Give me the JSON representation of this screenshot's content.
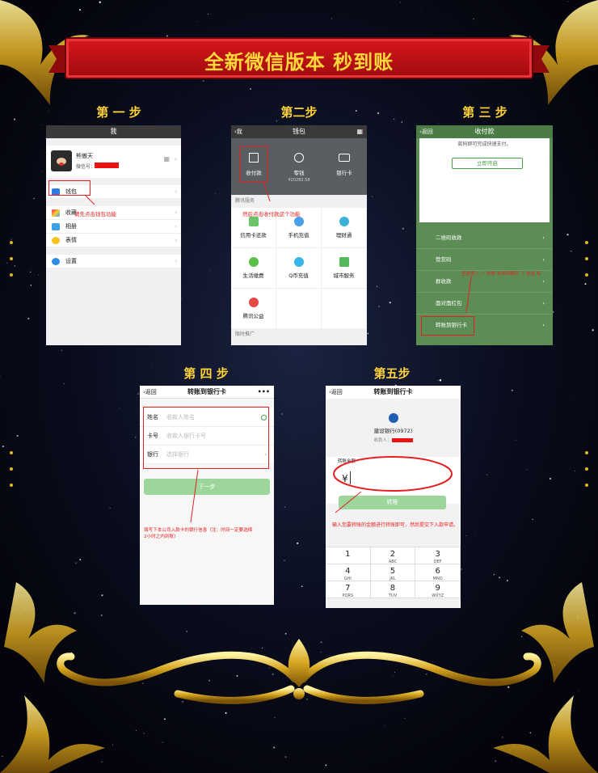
{
  "banner": {
    "title": "全新微信版本  秒到账"
  },
  "steps": {
    "s1": "第 一 步",
    "s2": "第二步",
    "s3": "第 三 步",
    "s4": "第 四 步",
    "s5": "第五步"
  },
  "p1": {
    "nav_title": "我",
    "profile_name": "熊傲天",
    "wechat_id_label": "微信号：",
    "qr_symbol": "▦",
    "menu": [
      "钱包",
      "收藏",
      "相册",
      "表情",
      "设置"
    ],
    "note": "请先点击钱包功能",
    "chev": "›"
  },
  "p2": {
    "back": "‹我",
    "nav_title": "钱包",
    "top": [
      {
        "label": "收付款",
        "sub": ""
      },
      {
        "label": "零钱",
        "sub": "¥20282.58"
      },
      {
        "label": "银行卡",
        "sub": ""
      }
    ],
    "section": "腾讯服务",
    "note": "然后点击收付款这个功能",
    "services": [
      "信用卡还款",
      "手机充值",
      "理财通",
      "生活缴费",
      "Q币充值",
      "城市服务",
      "腾讯公益"
    ],
    "footer": "限时推广"
  },
  "p3": {
    "back": "‹返回",
    "nav_title": "收付款",
    "card_text": "款码即可完成快速支付。",
    "open_btn": "立即开启",
    "items": [
      "二维码收款",
      "赞赏码",
      "群收款",
      "面对面红包",
      "转账到银行卡"
    ],
    "note": "至这里入 一 作收 去转到银行 了 在此 标"
  },
  "p4": {
    "back": "‹返回",
    "nav_title": "转账到银行卡",
    "more": "•••",
    "fields": [
      {
        "label": "姓名",
        "placeholder": "收款人姓名"
      },
      {
        "label": "卡号",
        "placeholder": "收款人银行卡号"
      },
      {
        "label": "银行",
        "placeholder": "选择银行"
      }
    ],
    "next_btn": "下一步",
    "note_line1": "填写下本公司入款卡的银行信息（注：时间一定要选择",
    "note_line2": "2小时之内到账）"
  },
  "p5": {
    "back": "‹返回",
    "nav_title": "转账到银行卡",
    "bank": "建设银行(0972)",
    "payee_label": "收款人：",
    "amount_label": "转账金额",
    "currency": "¥",
    "transfer_btn": "转账",
    "note": "输入您要转账的金额进行转账即可，然后提交下入款申请。",
    "keys": [
      {
        "n": "1",
        "l": ""
      },
      {
        "n": "2",
        "l": "ABC"
      },
      {
        "n": "3",
        "l": "DEF"
      },
      {
        "n": "4",
        "l": "GHI"
      },
      {
        "n": "5",
        "l": "JKL"
      },
      {
        "n": "6",
        "l": "MNO"
      },
      {
        "n": "7",
        "l": "PQRS"
      },
      {
        "n": "8",
        "l": "TUV"
      },
      {
        "n": "9",
        "l": "WXYZ"
      }
    ]
  }
}
